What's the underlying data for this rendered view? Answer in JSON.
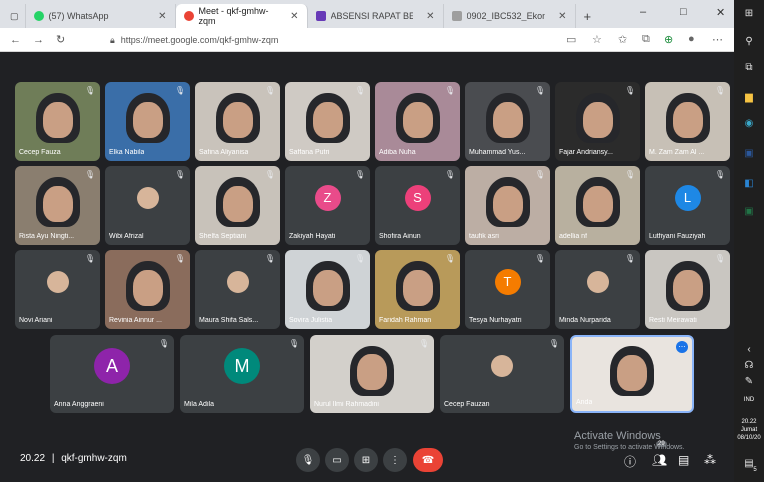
{
  "browser": {
    "tabs": [
      {
        "label": "(57) WhatsApp",
        "color": "#25d366"
      },
      {
        "label": "Meet - qkf-gmhw-zqm",
        "color": "#ea4335",
        "active": true
      },
      {
        "label": "ABSENSI RAPAT BESAR SELOMI",
        "color": "#673ab7"
      },
      {
        "label": "0902_IBC532_Ekonomi Perkotaa",
        "color": "#9e9e9e"
      }
    ],
    "new_tab": "+",
    "url": "https://meet.google.com/qkf-gmhw-zqm",
    "window": {
      "minimize": "–",
      "maximize": "□",
      "close": "✕"
    }
  },
  "participants": [
    {
      "name": "Cecep Fauza",
      "type": "video",
      "bg": "#6f7d58"
    },
    {
      "name": "Elka Nabila",
      "type": "video",
      "bg": "#3a6ea8"
    },
    {
      "name": "Safina Aliyanisa",
      "type": "video",
      "bg": "#c9c3bb"
    },
    {
      "name": "Saffana Putri",
      "type": "video",
      "bg": "#cfcac4"
    },
    {
      "name": "Adiba Nuha",
      "type": "video",
      "bg": "#a98a98"
    },
    {
      "name": "Muhammad Yus...",
      "type": "video",
      "bg": "#4a4c50"
    },
    {
      "name": "Fajar Andriansy...",
      "type": "video",
      "bg": "#2b2b2b"
    },
    {
      "name": "M. Zam Zam Al ...",
      "type": "video",
      "bg": "#c7c0b6"
    },
    {
      "name": "Rista Ayu Ningti...",
      "type": "video",
      "bg": "#8a7e6f"
    },
    {
      "name": "Wibi Afrizal",
      "type": "photo",
      "bg": "#3c4043"
    },
    {
      "name": "Shelfa Septiani",
      "type": "video",
      "bg": "#c8c2ba"
    },
    {
      "name": "Zakiyah Hayati",
      "type": "avatar",
      "letter": "Z",
      "color": "#e94b8a"
    },
    {
      "name": "Shofira Ainun",
      "type": "avatar",
      "letter": "S",
      "color": "#ec407a"
    },
    {
      "name": "taufik asri",
      "type": "video",
      "bg": "#bcaea4"
    },
    {
      "name": "adellia nf",
      "type": "video",
      "bg": "#b8b09f"
    },
    {
      "name": "Lutfiyani Fauziyah",
      "type": "avatar",
      "letter": "L",
      "color": "#1e88e5"
    },
    {
      "name": "Novi Ariani",
      "type": "photo",
      "bg": "#3c4043"
    },
    {
      "name": "Revinia Ainnur ...",
      "type": "video",
      "bg": "#8a6c5c"
    },
    {
      "name": "Maura Shifa Sals...",
      "type": "photo",
      "bg": "#3c4043"
    },
    {
      "name": "Sovira Julistia",
      "type": "video",
      "bg": "#cfd3d6"
    },
    {
      "name": "Faridah Rahman",
      "type": "video",
      "bg": "#b89a5a"
    },
    {
      "name": "Tesya Nurhayatri",
      "type": "avatar",
      "letter": "T",
      "color": "#f57c00"
    },
    {
      "name": "Minda Nurparida",
      "type": "photo",
      "bg": "#3c4043"
    },
    {
      "name": "Resti Meirawati",
      "type": "video",
      "bg": "#c9c6c1"
    }
  ],
  "bottom_row": [
    {
      "name": "Anna Anggraeni",
      "type": "avatar",
      "letter": "A",
      "color": "#8e24aa"
    },
    {
      "name": "Mila Adila",
      "type": "avatar",
      "letter": "M",
      "color": "#00897b"
    },
    {
      "name": "Nurul Ilmi Rahmadini",
      "type": "video",
      "bg": "#d3d0cb"
    },
    {
      "name": "Cecep Fauzan",
      "type": "photo",
      "bg": "#3c4043"
    },
    {
      "name": "Anda",
      "type": "video",
      "bg": "#e9e4df",
      "self": true
    }
  ],
  "meeting": {
    "time": "20.22",
    "separator": "|",
    "code": "qkf-gmhw-zqm",
    "participant_count": "29"
  },
  "watermark": {
    "line1": "Activate Windows",
    "line2": "Go to Settings to activate Windows."
  },
  "taskbar": {
    "time": "20.22",
    "day": "Jumat",
    "date": "08/10/20",
    "lang": "IND",
    "notif": "5"
  }
}
